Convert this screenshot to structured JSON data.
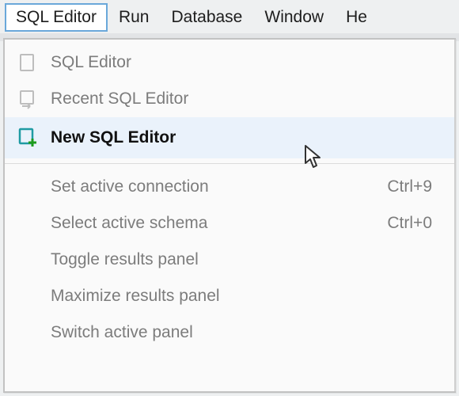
{
  "menubar": {
    "items": [
      {
        "label": "SQL Editor",
        "active": true
      },
      {
        "label": "Run"
      },
      {
        "label": "Database"
      },
      {
        "label": "Window"
      },
      {
        "label": "He"
      }
    ]
  },
  "dropdown": {
    "rows": [
      {
        "label": "SQL Editor",
        "icon": "sql-editor-icon",
        "enabled": false
      },
      {
        "label": "Recent SQL Editor",
        "icon": "recent-sql-editor-icon",
        "enabled": false
      },
      {
        "label": "New SQL Editor",
        "icon": "new-sql-editor-icon",
        "enabled": true,
        "hovered": true
      },
      {
        "divider": true
      },
      {
        "label": "Set active connection",
        "shortcut": "Ctrl+9",
        "enabled": false
      },
      {
        "label": "Select active schema",
        "shortcut": "Ctrl+0",
        "enabled": false
      },
      {
        "label": "Toggle results panel",
        "enabled": false
      },
      {
        "label": "Maximize results panel",
        "enabled": false
      },
      {
        "label": "Switch active panel",
        "enabled": false
      }
    ]
  }
}
